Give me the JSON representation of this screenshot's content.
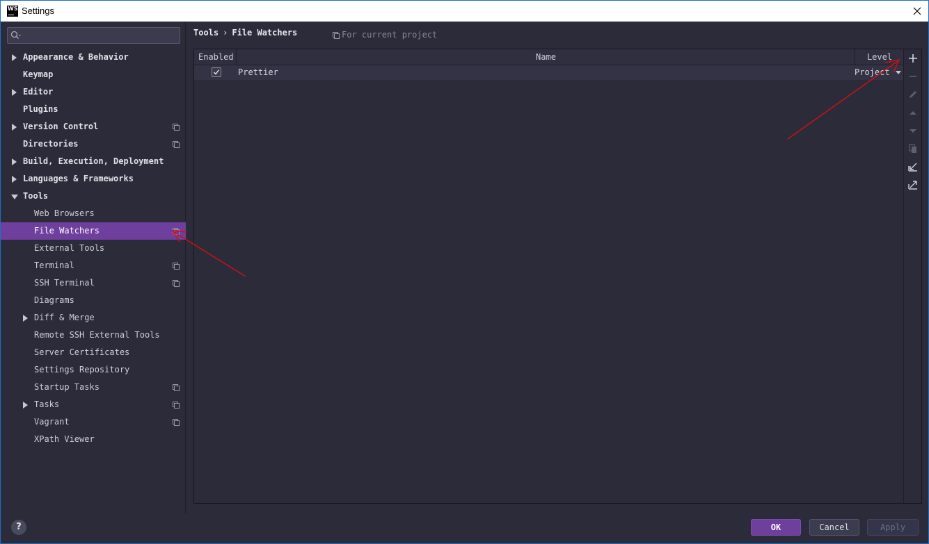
{
  "window": {
    "title": "Settings",
    "app_icon": "WS"
  },
  "search": {
    "placeholder": ""
  },
  "sidebar": {
    "items": [
      {
        "label": "Appearance & Behavior",
        "level": 1,
        "expandable": true,
        "expanded": false,
        "project_icon": false
      },
      {
        "label": "Keymap",
        "level": 1,
        "expandable": false,
        "project_icon": false
      },
      {
        "label": "Editor",
        "level": 1,
        "expandable": true,
        "expanded": false,
        "project_icon": false
      },
      {
        "label": "Plugins",
        "level": 1,
        "expandable": false,
        "project_icon": false
      },
      {
        "label": "Version Control",
        "level": 1,
        "expandable": true,
        "expanded": false,
        "project_icon": true
      },
      {
        "label": "Directories",
        "level": 1,
        "expandable": false,
        "project_icon": true
      },
      {
        "label": "Build, Execution, Deployment",
        "level": 1,
        "expandable": true,
        "expanded": false,
        "project_icon": false
      },
      {
        "label": "Languages & Frameworks",
        "level": 1,
        "expandable": true,
        "expanded": false,
        "project_icon": false
      },
      {
        "label": "Tools",
        "level": 1,
        "expandable": true,
        "expanded": true,
        "project_icon": false
      },
      {
        "label": "Web Browsers",
        "level": 2,
        "expandable": false,
        "project_icon": false
      },
      {
        "label": "File Watchers",
        "level": 2,
        "expandable": false,
        "project_icon": true,
        "selected": true
      },
      {
        "label": "External Tools",
        "level": 2,
        "expandable": false,
        "project_icon": false
      },
      {
        "label": "Terminal",
        "level": 2,
        "expandable": false,
        "project_icon": true
      },
      {
        "label": "SSH Terminal",
        "level": 2,
        "expandable": false,
        "project_icon": true
      },
      {
        "label": "Diagrams",
        "level": 2,
        "expandable": false,
        "project_icon": false
      },
      {
        "label": "Diff & Merge",
        "level": 2,
        "expandable": true,
        "expanded": false,
        "project_icon": false
      },
      {
        "label": "Remote SSH External Tools",
        "level": 2,
        "expandable": false,
        "project_icon": false
      },
      {
        "label": "Server Certificates",
        "level": 2,
        "expandable": false,
        "project_icon": false
      },
      {
        "label": "Settings Repository",
        "level": 2,
        "expandable": false,
        "project_icon": false
      },
      {
        "label": "Startup Tasks",
        "level": 2,
        "expandable": false,
        "project_icon": true
      },
      {
        "label": "Tasks",
        "level": 2,
        "expandable": true,
        "expanded": false,
        "project_icon": true
      },
      {
        "label": "Vagrant",
        "level": 2,
        "expandable": false,
        "project_icon": true
      },
      {
        "label": "XPath Viewer",
        "level": 2,
        "expandable": false,
        "project_icon": false
      }
    ]
  },
  "breadcrumb": {
    "parent": "Tools",
    "separator": "›",
    "current": "File Watchers"
  },
  "scope_hint": "For current project",
  "table": {
    "columns": {
      "enabled": "Enabled",
      "name": "Name",
      "level": "Level"
    },
    "rows": [
      {
        "enabled": true,
        "name": "Prettier",
        "level": "Project"
      }
    ]
  },
  "toolbar_icons": [
    "add-icon",
    "remove-icon",
    "edit-icon",
    "move-up-icon",
    "move-down-icon",
    "copy-icon",
    "import-icon",
    "export-icon"
  ],
  "buttons": {
    "help": "?",
    "ok": "OK",
    "cancel": "Cancel",
    "apply": "Apply"
  },
  "colors": {
    "accent": "#6f3f9e",
    "background": "#2b2b3a",
    "annotation": "#cc1111"
  }
}
